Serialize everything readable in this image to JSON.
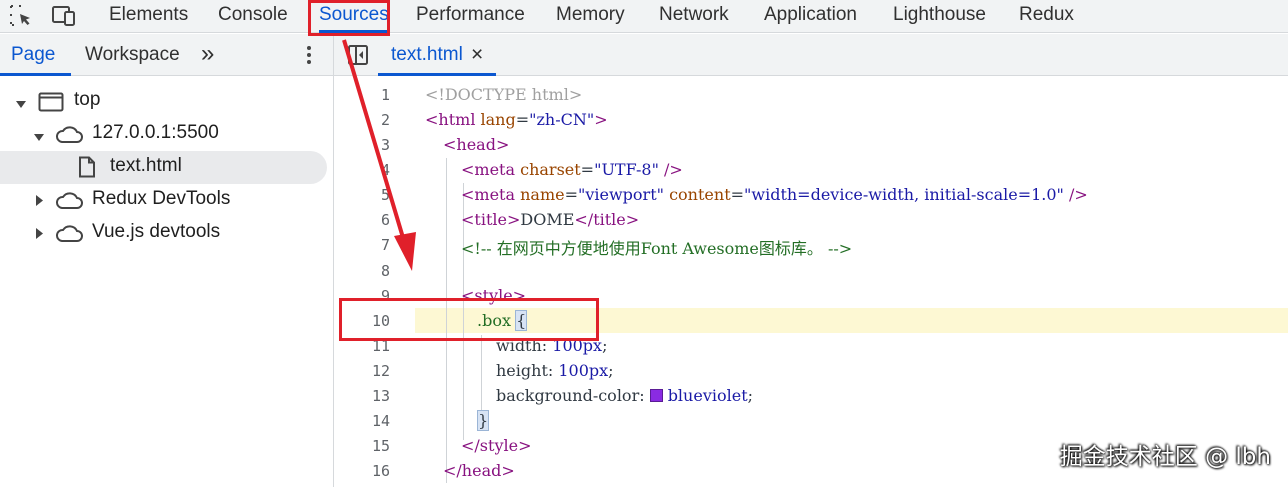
{
  "top_tabs": [
    "Elements",
    "Console",
    "Sources",
    "Performance",
    "Memory",
    "Network",
    "Application",
    "Lighthouse",
    "Redux"
  ],
  "active_top_tab": "Sources",
  "sub_tabs": {
    "page": "Page",
    "workspace": "Workspace",
    "more": "»"
  },
  "editor_tab": {
    "filename": "text.html",
    "close": "×"
  },
  "tree": [
    {
      "label": "top"
    },
    {
      "label": "127.0.0.1:5500"
    },
    {
      "label": "text.html"
    },
    {
      "label": "Redux DevTools"
    },
    {
      "label": "Vue.js devtools"
    }
  ],
  "line_numbers": [
    "1",
    "2",
    "3",
    "4",
    "5",
    "6",
    "7",
    "8",
    "9",
    "10",
    "11",
    "12",
    "13",
    "14",
    "15",
    "16"
  ],
  "code": {
    "l1": "<!DOCTYPE html>",
    "l2_open": "<html ",
    "l2_attr": "lang",
    "l2_eq": "=",
    "l2_val": "\"zh-CN\"",
    "l2_close": ">",
    "l3": "<head>",
    "l4_open": "<meta ",
    "l4_attr": "charset",
    "l4_eq": "=",
    "l4_val": "\"UTF-8\"",
    "l4_close": " />",
    "l5_open": "<meta ",
    "l5_attr1": "name",
    "l5_eq1": "=",
    "l5_val1": "\"viewport\"",
    "l5_attr2": " content",
    "l5_eq2": "=",
    "l5_val2": "\"width=device-width, initial-scale=1.0\"",
    "l5_close": " />",
    "l6_open": "<title>",
    "l6_text": "DOME",
    "l6_close": "</title>",
    "l7": "<!-- 在网页中方便地使用Font Awesome图标库。 -->",
    "l9": "<style>",
    "l10_sel": ".box ",
    "l10_brace": "{",
    "l11_prop": "width: ",
    "l11_val": "100px",
    "l11_semi": ";",
    "l12_prop": "height: ",
    "l12_val": "100px",
    "l12_semi": ";",
    "l13_prop": "background-color: ",
    "l13_val": "blueviolet",
    "l13_semi": ";",
    "l14": "}",
    "l15": "</style>",
    "l16": "</head>"
  },
  "swatch_color": "#8a2be2",
  "watermark": "掘金技术社区 @ lbh",
  "icons": [
    "inspect-element-icon",
    "device-toolbar-icon",
    "more-vertical-icon",
    "toggle-sidebar-icon",
    "frame-icon",
    "cloud-icon",
    "file-icon",
    "red-arrow-annotation"
  ]
}
